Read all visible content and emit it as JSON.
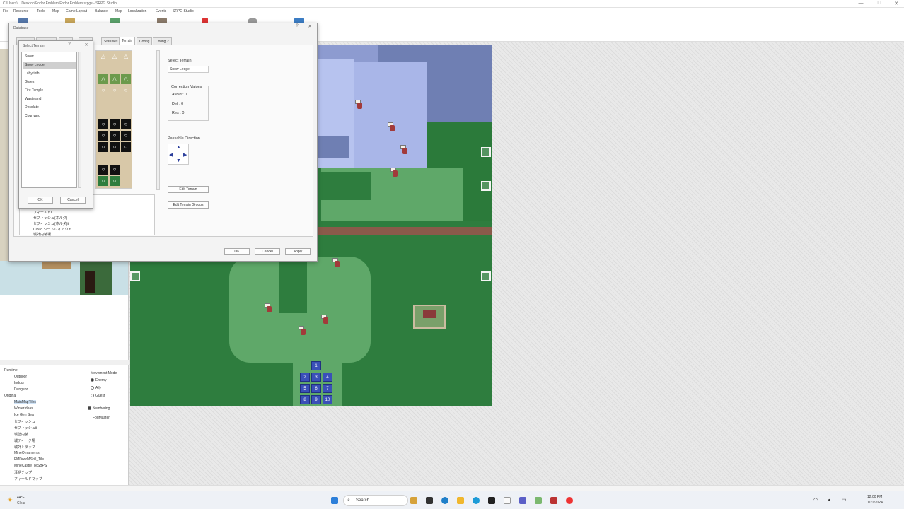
{
  "window": {
    "title": "C:\\Users\\...\\Desktop\\Fodor Emblem\\Fodor Emblem.srpgs - SRPG Studio",
    "controls": {
      "minimize": "—",
      "maximize": "□",
      "close": "✕"
    }
  },
  "menu": [
    "File",
    "Resource",
    "Tools",
    "Map",
    "Game Layout",
    "Balance",
    "Map",
    "Localization",
    "Events",
    "SRPG Studio"
  ],
  "tileset_panel": {},
  "tree": {
    "items": [
      {
        "label": "Runtime",
        "indent": 0
      },
      {
        "label": "Outdoor",
        "indent": 1
      },
      {
        "label": "Indoor",
        "indent": 1
      },
      {
        "label": "Dungeon",
        "indent": 1
      },
      {
        "label": "Original",
        "indent": 0
      },
      {
        "label": "MainMapTiles",
        "indent": 1
      },
      {
        "label": "WinterIdeas",
        "indent": 1
      },
      {
        "label": "Ice Gen Sea",
        "indent": 1
      },
      {
        "label": "セフィッシュ",
        "indent": 1
      },
      {
        "label": "セフィッシュⅡ",
        "indent": 1
      },
      {
        "label": "城壁内装",
        "indent": 1
      },
      {
        "label": "城ティーク場",
        "indent": 1
      },
      {
        "label": "城外トラップ",
        "indent": 1
      },
      {
        "label": "MineOrnaments",
        "indent": 1
      },
      {
        "label": "FMDoorMSkill_Tile",
        "indent": 1
      },
      {
        "label": "MineCastleTileSBPS",
        "indent": 1
      },
      {
        "label": "漢語チップ",
        "indent": 1
      },
      {
        "label": "フィールドマップ",
        "indent": 1
      }
    ],
    "selected_index": 5,
    "movement_mode_label": "Movement Mode",
    "modes": [
      "Enemy",
      "Ally",
      "Guest"
    ],
    "checked_mode": 0,
    "numbering_label": "Numbering",
    "numbering_checked": true,
    "fogmaster_label": "FogMaster",
    "fogmaster_checked": false
  },
  "database_dialog": {
    "title": "Database",
    "tabs": [
      "Classes",
      "Weapons",
      "Items",
      "Skills",
      "Statuses",
      "Terrain",
      "Config",
      "Config 2"
    ],
    "active_tab": "Terrain",
    "select_terrain_label": "Select Terrain",
    "select_terrain_value": "Snow Ledge",
    "correction_label": "Correction Values",
    "correction": [
      "Avoid : 0",
      "Def : 0",
      "Res : 0"
    ],
    "passable_label": "Passable Direction",
    "edit_terrain_btn": "Edit Terrain",
    "edit_groups_btn": "Edit Terrain Groups",
    "footer": {
      "ok": "OK",
      "cancel": "Cancel",
      "apply": "Apply"
    },
    "lower_list": [
      "フィールドⅠ",
      "セフィッシュ(ホルダ)",
      "セフィッシュ(ホルダ)Ⅱ",
      "Cloud シートレイアウト",
      "城外内装場"
    ]
  },
  "select_terrain_dialog": {
    "title": "Select Terrain",
    "help": "?",
    "close": "✕",
    "items": [
      "Snow",
      "Snow Ledge",
      "Labyrinth",
      "Gates",
      "Fire Temple",
      "Wasteland",
      "Desolate",
      "Courtyard"
    ],
    "selected": 1,
    "ok": "OK",
    "cancel": "Cancel"
  },
  "map": {
    "numbered_tiles": [
      "1",
      "2",
      "3",
      "4",
      "5",
      "6",
      "7",
      "8",
      "9",
      "10"
    ]
  },
  "taskbar": {
    "search_placeholder": "Search",
    "weather_temp": "44°F",
    "weather_desc": "Clear",
    "time": "12:00 PM",
    "date": "11/1/2024"
  },
  "colors": {
    "forest": "#2e7d3e",
    "grass": "#5fa869",
    "snow": "#a9b6e8",
    "rock": "#6f7fb3",
    "accent_blue": "#3a50b8",
    "bridge": "#8a5a4a"
  }
}
